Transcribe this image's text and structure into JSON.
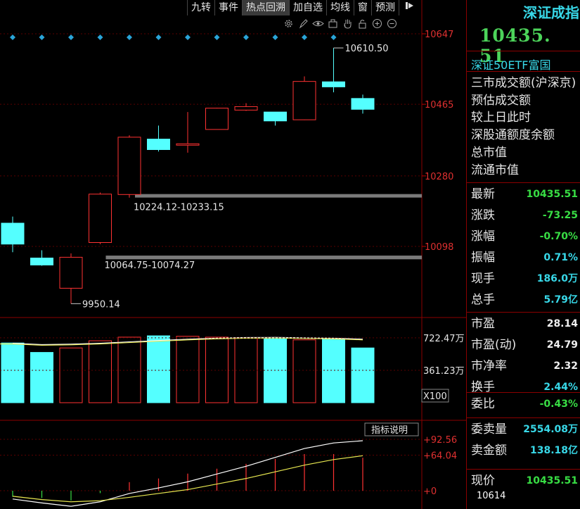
{
  "toolbar": {
    "items": [
      "九转",
      "事件",
      "热点回溯",
      "加自选",
      "均线",
      "窗",
      "预测"
    ],
    "active": "热点回溯"
  },
  "icons": [
    "gear-icon",
    "pen-icon",
    "eye-icon",
    "briefcase-icon",
    "hand-icon",
    "lock-icon",
    "zoom-in-icon",
    "zoom-out-icon"
  ],
  "right_panel": {
    "title": "深证成指",
    "price": "10435. 51",
    "link": "深证50ETF富国",
    "list": [
      "三市成交额(沪深京)",
      "预估成交额",
      "较上日此时",
      "深股通额度余额",
      "总市值",
      "流通市值"
    ],
    "stats1": [
      {
        "label": "最新",
        "value": "10435.51",
        "color": "g"
      },
      {
        "label": "涨跌",
        "value": "-73.25",
        "color": "g"
      },
      {
        "label": "涨幅",
        "value": "-0.70%",
        "color": "g"
      },
      {
        "label": "振幅",
        "value": "0.71%",
        "color": "c"
      },
      {
        "label": "现手",
        "value": "186.0万",
        "color": "c"
      },
      {
        "label": "总手",
        "value": "5.79亿",
        "color": "c"
      }
    ],
    "stats2": [
      {
        "label": "市盈",
        "value": "28.14",
        "color": "w"
      },
      {
        "label": "市盈(动)",
        "value": "24.79",
        "color": "w"
      },
      {
        "label": "市净率",
        "value": "2.32",
        "color": "w"
      },
      {
        "label": "换手",
        "value": "2.44%",
        "color": "c"
      }
    ],
    "stats3": [
      {
        "label": "委比",
        "value": "-0.43%",
        "color": "g"
      }
    ],
    "stats4": [
      {
        "label": "委卖量",
        "value": "2554.08万",
        "color": "c"
      },
      {
        "label": "卖金额",
        "value": "138.18亿",
        "color": "c"
      }
    ],
    "stats5": [
      {
        "label": "现价",
        "value": "10435.51",
        "color": "g"
      }
    ]
  },
  "bottom_price": "10614",
  "chart_data": {
    "type": "candlestick",
    "price_axis": {
      "ticks": [
        "10647",
        "10465",
        "10280",
        "10098"
      ],
      "tick_values": [
        10647,
        10465,
        10280,
        10098
      ],
      "ylim": [
        9930,
        10660
      ]
    },
    "candles": [
      {
        "o": 10158,
        "c": 10104,
        "h": 10175,
        "l": 10083
      },
      {
        "o": 10068,
        "c": 10050,
        "h": 10088,
        "l": 10048
      },
      {
        "o": 9990,
        "c": 10070,
        "h": 10080,
        "l": 9950.14
      },
      {
        "o": 10108,
        "c": 10233,
        "h": 10237,
        "l": 10104
      },
      {
        "o": 10232,
        "c": 10380,
        "h": 10385,
        "l": 10224
      },
      {
        "o": 10375,
        "c": 10348,
        "h": 10410,
        "l": 10343
      },
      {
        "o": 10362,
        "c": 10363,
        "h": 10445,
        "l": 10340
      },
      {
        "o": 10400,
        "c": 10455,
        "h": 10456,
        "l": 10400
      },
      {
        "o": 10450,
        "c": 10459,
        "h": 10468,
        "l": 10448
      },
      {
        "o": 10445,
        "c": 10422,
        "h": 10445,
        "l": 10410
      },
      {
        "o": 10425,
        "c": 10524,
        "h": 10537,
        "l": 10424
      },
      {
        "o": 10523,
        "c": 10510,
        "h": 10610.5,
        "l": 10496
      },
      {
        "o": 10480,
        "c": 10452,
        "h": 10490,
        "l": 10441
      }
    ],
    "labels": [
      {
        "text": "10610.50",
        "candle": 11,
        "price": 10610.5,
        "side": "right"
      },
      {
        "text": "10224.12-10233.15",
        "candle": 4,
        "price": 10224,
        "side": "band"
      },
      {
        "text": "10064.75-10074.27",
        "candle": 3,
        "price": 10074,
        "side": "band"
      },
      {
        "text": "9950.14",
        "candle": 2,
        "price": 9950.14,
        "side": "right"
      }
    ],
    "gaps": [
      {
        "from": 10224.12,
        "to": 10233.15,
        "start_candle": 4
      },
      {
        "from": 10064.75,
        "to": 10074.27,
        "start_candle": 3
      }
    ],
    "volume": {
      "ticks": [
        "722.47万",
        "361.23万"
      ],
      "tick_values": [
        722.47,
        361.23
      ],
      "unit_label": "X100",
      "values": [
        665,
        560,
        610,
        690,
        730,
        745,
        740,
        730,
        725,
        720,
        700,
        710,
        610
      ],
      "ma": [
        655,
        640,
        645,
        655,
        670,
        685,
        700,
        712,
        718,
        720,
        715,
        712,
        700
      ],
      "ylim": [
        0,
        800
      ]
    },
    "macd": {
      "button": "指标说明",
      "ticks": [
        "+92.56",
        "+64.04",
        "+0"
      ],
      "tick_values": [
        92.56,
        64.04,
        0
      ],
      "dif": [
        -15,
        -22,
        -28,
        -20,
        -5,
        5,
        16,
        30,
        44,
        60,
        76,
        86,
        90
      ],
      "dea": [
        -10,
        -16,
        -20,
        -18,
        -12,
        -5,
        2,
        12,
        22,
        34,
        46,
        56,
        63
      ],
      "hist": [
        -5,
        -6,
        -8,
        -2,
        7,
        10,
        14,
        18,
        22,
        26,
        30,
        30,
        27
      ],
      "ylim": [
        -30,
        100
      ]
    },
    "markers_count": 12
  }
}
